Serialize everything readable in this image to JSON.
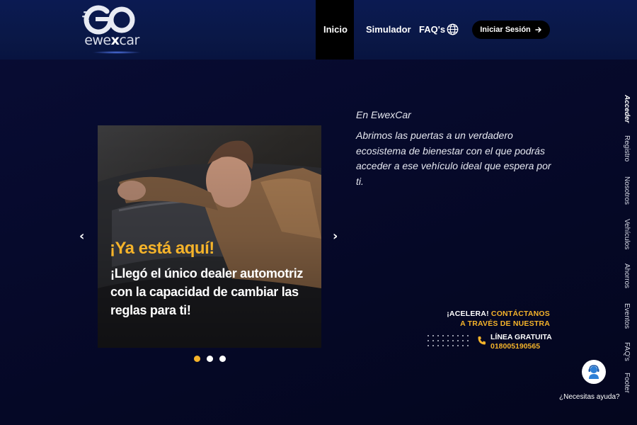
{
  "header": {
    "logo_text_a": "ewe",
    "logo_text_b": "x",
    "logo_text_c": "car",
    "nav": [
      {
        "label": "Inicio"
      },
      {
        "label": "Simulador"
      },
      {
        "label": "FAQ's"
      }
    ],
    "login_label": "Iniciar Sesión"
  },
  "carousel": {
    "title": "¡Ya está aquí!",
    "subtitle": "¡Llegó el único dealer automotriz con la capacidad de cambiar las reglas para ti!",
    "prev_arrow": "‹",
    "next_arrow": "›",
    "active_index": 0,
    "slide_count": 3
  },
  "intro": {
    "title": "En EwexCar",
    "body": "Abrimos las puertas a un verdadero ecosistema de bienestar con el que podrás acceder a ese vehículo ideal que espera por ti."
  },
  "contact": {
    "line1_a": "¡ACELERA!",
    "line1_b": "CONTÁCTANOS",
    "line2": "A TRAVÉS DE NUESTRA",
    "line_label": "LÍNEA GRATUITA",
    "line_number": "018005190565"
  },
  "side_menu": [
    {
      "label": "Acceder"
    },
    {
      "label": "Registro"
    },
    {
      "label": "Nosotros"
    },
    {
      "label": "Vehículos"
    },
    {
      "label": "Ahorros"
    },
    {
      "label": "Eventos"
    },
    {
      "label": "FAQ's"
    },
    {
      "label": "Footer"
    }
  ],
  "help": {
    "label": "¿Necesitas ayuda?"
  },
  "colors": {
    "accent": "#f5b32a",
    "header_bg": "#0b1a52",
    "page_bg": "#06092a"
  },
  "icons": [
    "globe-icon",
    "arrow-right-icon",
    "phone-icon",
    "support-agent-icon"
  ]
}
